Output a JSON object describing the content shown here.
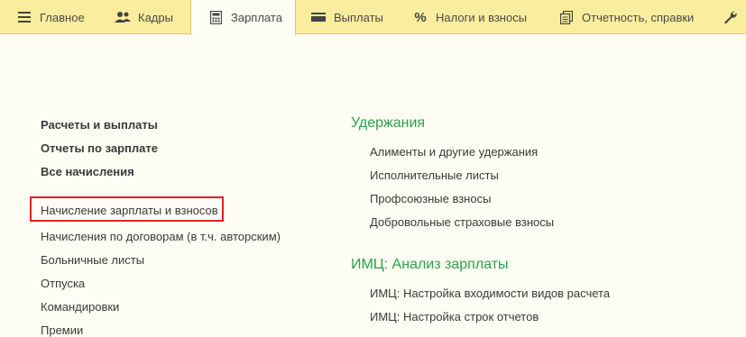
{
  "nav": {
    "tabs": [
      {
        "label": "Главное",
        "icon": "hamburger-icon"
      },
      {
        "label": "Кадры",
        "icon": "people-icon"
      },
      {
        "label": "Зарплата",
        "icon": "calculator-icon"
      },
      {
        "label": "Выплаты",
        "icon": "wallet-icon"
      },
      {
        "label": "Налоги и взносы",
        "icon": "percent-icon"
      },
      {
        "label": "Отчетность, справки",
        "icon": "documents-icon"
      },
      {
        "icon": "wrench-icon"
      }
    ],
    "active_tab": "Зарплата"
  },
  "left": {
    "bold_links": [
      "Расчеты и выплаты",
      "Отчеты по зарплате",
      "Все начисления"
    ],
    "links": [
      "Начисление зарплаты и взносов",
      "Начисления по договорам (в т.ч. авторским)",
      "Больничные листы",
      "Отпуска",
      "Командировки",
      "Премии"
    ]
  },
  "right": {
    "groups": [
      {
        "title": "Удержания",
        "links": [
          "Алименты и другие удержания",
          "Исполнительные листы",
          "Профсоюзные взносы",
          "Добровольные страховые взносы"
        ]
      },
      {
        "title": "ИМЦ: Анализ зарплаты",
        "links": [
          "ИМЦ: Настройка входимости видов расчета",
          "ИМЦ: Настройка строк отчетов"
        ]
      }
    ]
  },
  "colors": {
    "topbar": "#fbed9e",
    "background": "#fdfdf3",
    "group_title": "#2ea04a",
    "highlight": "#e02020"
  }
}
